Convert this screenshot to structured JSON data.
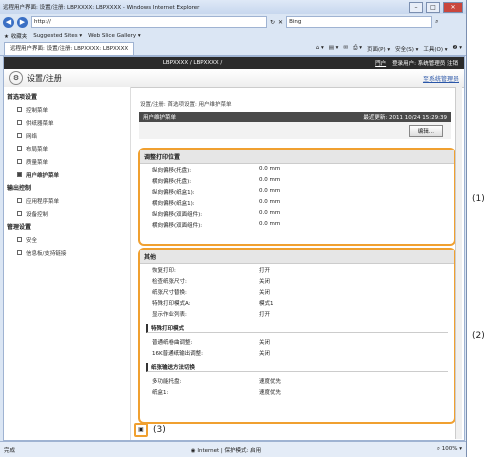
{
  "browser": {
    "title": "远程用户界面: 设置/注册: LBPXXXX: LBPXXXX - Windows Internet Explorer",
    "address": "http://",
    "search_placeholder": "Bing",
    "favorites": {
      "label": "收藏夹",
      "suggested": "Suggested Sites ▾",
      "gallery": "Web Slice Gallery ▾"
    },
    "tab_label": "远程用户界面: 设置/注册: LBPXXXX: LBPXXXX",
    "commands": [
      "页面(P) ▾",
      "安全(S) ▾",
      "工具(O) ▾",
      "❷ ▾"
    ]
  },
  "header": {
    "device": "LBPXXXX / LBPXXXX /",
    "portal": "門户",
    "user": "登录用户: 系统管理员 注销"
  },
  "subheader": {
    "title": "设置/注册",
    "mail_link": "至系统管理员"
  },
  "sidebar": [
    {
      "group": "首选项设置",
      "items": [
        {
          "label": "控制菜单"
        },
        {
          "label": "供纸器菜单"
        },
        {
          "label": "网络"
        },
        {
          "label": "布局菜单"
        },
        {
          "label": "质量菜单"
        },
        {
          "label": "用户维护菜单",
          "selected": true
        }
      ]
    },
    {
      "group": "输出控制",
      "items": [
        {
          "label": "应用程序菜单"
        },
        {
          "label": "设备控制"
        }
      ]
    },
    {
      "group": "管理设置",
      "items": [
        {
          "label": "安全"
        },
        {
          "label": "信息板/支持链接"
        }
      ]
    }
  ],
  "main": {
    "breadcrumb": "设置/注册: 首选项设置: 用户维护菜单",
    "page_title": "用户维护菜单",
    "last_updated": "最近更新: 2011 10/24 15:29:39",
    "edit_button": "编辑...",
    "section1": {
      "heading": "调整打印位置",
      "rows": [
        {
          "k": "纵向偏移(托盘):",
          "v": "0.0 mm"
        },
        {
          "k": "横向偏移(托盘):",
          "v": "0.0 mm"
        },
        {
          "k": "纵向偏移(纸盒1):",
          "v": "0.0 mm"
        },
        {
          "k": "横向偏移(纸盒1):",
          "v": "0.0 mm"
        },
        {
          "k": "纵向偏移(双面组件):",
          "v": "0.0 mm"
        },
        {
          "k": "横向偏移(双面组件):",
          "v": "0.0 mm"
        }
      ]
    },
    "section2": {
      "heading": "其他",
      "rows": [
        {
          "k": "恢复打印:",
          "v": "打开"
        },
        {
          "k": "检查纸张尺寸:",
          "v": "关闭"
        },
        {
          "k": "纸张尺寸替换:",
          "v": "关闭"
        },
        {
          "k": "特殊打印模式A:",
          "v": "模式1"
        },
        {
          "k": "显示作业列表:",
          "v": "打开"
        }
      ],
      "sub1": {
        "heading": "特殊打印模式",
        "rows": [
          {
            "k": "普通纸卷曲调整:",
            "v": "关闭"
          },
          {
            "k": "16K普通纸输出调整:",
            "v": "关闭"
          }
        ]
      },
      "sub2": {
        "heading": "纸张输送方法切换",
        "rows": [
          {
            "k": "多功能托盘:",
            "v": "速度优先"
          },
          {
            "k": "纸盒1:",
            "v": "速度优先"
          }
        ]
      }
    }
  },
  "callouts": {
    "c1": "(1)",
    "c2": "(2)",
    "c3": "(3)"
  },
  "status": {
    "left": "完成",
    "zone": "Internet | 保护模式: 启用",
    "zoom": "100%"
  }
}
